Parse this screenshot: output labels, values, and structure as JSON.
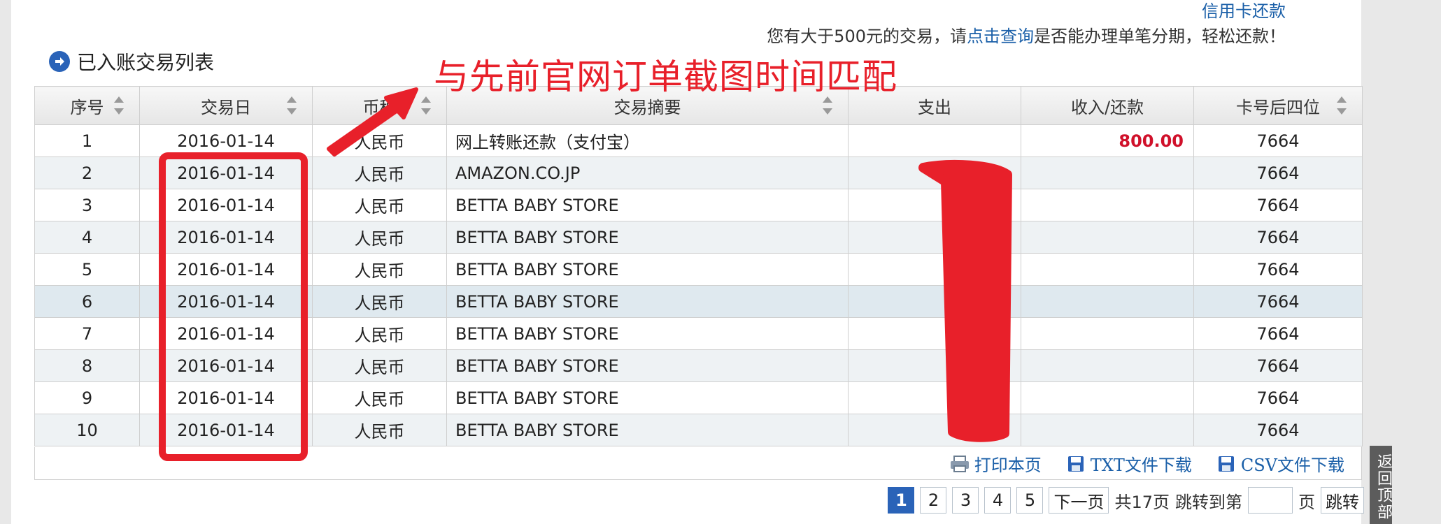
{
  "header": {
    "link": "信用卡还款",
    "notice_pre": "您有大于500元的交易，请",
    "notice_link": "点击查询",
    "notice_post": "是否能办理单笔分期，轻松还款！",
    "section_title": "已入账交易列表"
  },
  "annotation": {
    "text": "与先前官网订单截图时间匹配",
    "color": "#e8202a"
  },
  "table": {
    "columns": [
      "序号",
      "交易日",
      "币种",
      "交易摘要",
      "支出",
      "收入/还款",
      "卡号后四位"
    ],
    "rows": [
      {
        "no": "1",
        "date": "2016-01-14",
        "currency": "人民币",
        "desc": "网上转账还款（支付宝）",
        "expense": "",
        "income": "800.00",
        "card": "7664"
      },
      {
        "no": "2",
        "date": "2016-01-14",
        "currency": "人民币",
        "desc": "AMAZON.CO.JP",
        "expense": "",
        "income": "",
        "card": "7664"
      },
      {
        "no": "3",
        "date": "2016-01-14",
        "currency": "人民币",
        "desc": "BETTA BABY STORE",
        "expense": "",
        "income": "",
        "card": "7664"
      },
      {
        "no": "4",
        "date": "2016-01-14",
        "currency": "人民币",
        "desc": "BETTA BABY STORE",
        "expense": "",
        "income": "",
        "card": "7664"
      },
      {
        "no": "5",
        "date": "2016-01-14",
        "currency": "人民币",
        "desc": "BETTA BABY STORE",
        "expense": "",
        "income": "",
        "card": "7664"
      },
      {
        "no": "6",
        "date": "2016-01-14",
        "currency": "人民币",
        "desc": "BETTA BABY STORE",
        "expense": "",
        "income": "",
        "card": "7664"
      },
      {
        "no": "7",
        "date": "2016-01-14",
        "currency": "人民币",
        "desc": "BETTA BABY STORE",
        "expense": "",
        "income": "",
        "card": "7664"
      },
      {
        "no": "8",
        "date": "2016-01-14",
        "currency": "人民币",
        "desc": "BETTA BABY STORE",
        "expense": "",
        "income": "",
        "card": "7664"
      },
      {
        "no": "9",
        "date": "2016-01-14",
        "currency": "人民币",
        "desc": "BETTA BABY STORE",
        "expense": "",
        "income": "",
        "card": "7664"
      },
      {
        "no": "10",
        "date": "2016-01-14",
        "currency": "人民币",
        "desc": "BETTA BABY STORE",
        "expense": "",
        "income": "",
        "card": "7664"
      }
    ]
  },
  "actions": {
    "print": "打印本页",
    "txt": "TXT文件下载",
    "csv": "CSV文件下载"
  },
  "pager": {
    "pages": [
      "1",
      "2",
      "3",
      "4",
      "5"
    ],
    "current": "1",
    "next": "下一页",
    "total": "共17页",
    "jump_pre": "跳转到第",
    "jump_post": "页",
    "jump_btn": "跳转"
  },
  "back_top": "返回顶部",
  "colors": {
    "accent": "#2a63b8",
    "link": "#1a5fa8",
    "income": "#d0102a",
    "annotation": "#e8202a"
  },
  "icons": [
    "arrow-right-circle-icon",
    "sort-icon",
    "printer-icon",
    "floppy-disk-icon"
  ]
}
